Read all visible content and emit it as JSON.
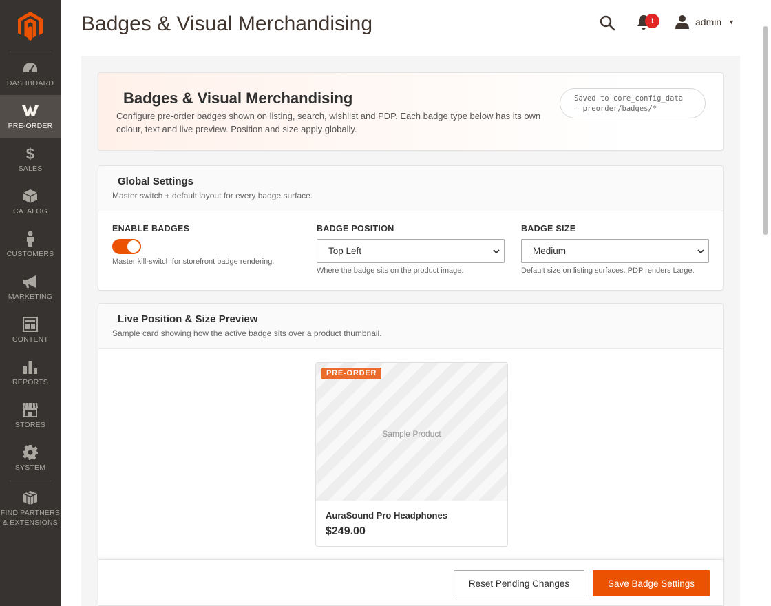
{
  "header": {
    "title": "Badges & Visual Merchandising",
    "notifications_count": "1",
    "user_name": "admin"
  },
  "sidebar": {
    "items": [
      {
        "label": "DASHBOARD",
        "icon": "dashboard-icon"
      },
      {
        "label": "PRE-ORDER",
        "icon": "preorder-icon",
        "active": true
      },
      {
        "label": "SALES",
        "icon": "dollar-icon"
      },
      {
        "label": "CATALOG",
        "icon": "box-icon"
      },
      {
        "label": "CUSTOMERS",
        "icon": "person-icon"
      },
      {
        "label": "MARKETING",
        "icon": "megaphone-icon"
      },
      {
        "label": "CONTENT",
        "icon": "layout-icon"
      },
      {
        "label": "REPORTS",
        "icon": "bar-chart-icon"
      },
      {
        "label": "STORES",
        "icon": "storefront-icon"
      },
      {
        "label": "SYSTEM",
        "icon": "gear-icon"
      },
      {
        "label": "FIND PARTNERS & EXTENSIONS",
        "icon": "blocks-icon"
      }
    ]
  },
  "intro": {
    "title": "Badges & Visual Merchandising",
    "description": "Configure pre-order badges shown on listing, search, wishlist and PDP. Each badge type below has its own colour, text and live preview. Position and size apply globally.",
    "saved_line1": "Saved to core_config_data",
    "saved_line2": "— preorder/badges/*"
  },
  "global_settings": {
    "title": "Global Settings",
    "subtitle": "Master switch + default layout for every badge surface.",
    "enable": {
      "label": "ENABLE BADGES",
      "enabled": true,
      "hint": "Master kill-switch for storefront badge rendering."
    },
    "position": {
      "label": "BADGE POSITION",
      "value": "Top Left",
      "hint": "Where the badge sits on the product image."
    },
    "size": {
      "label": "BADGE SIZE",
      "value": "Medium",
      "hint": "Default size on listing surfaces. PDP renders Large."
    }
  },
  "preview": {
    "title": "Live Position & Size Preview",
    "subtitle": "Sample card showing how the active badge sits over a product thumbnail.",
    "badge_text": "PRE-ORDER",
    "placeholder": "Sample Product",
    "product_name": "AuraSound Pro Headphones",
    "price": "$249.00"
  },
  "footer": {
    "reset_label": "Reset Pending Changes",
    "save_label": "Save Badge Settings"
  },
  "colors": {
    "accent": "#eb5202",
    "sidebar_bg": "#373330",
    "badge_bg": "#eb6b2a"
  }
}
